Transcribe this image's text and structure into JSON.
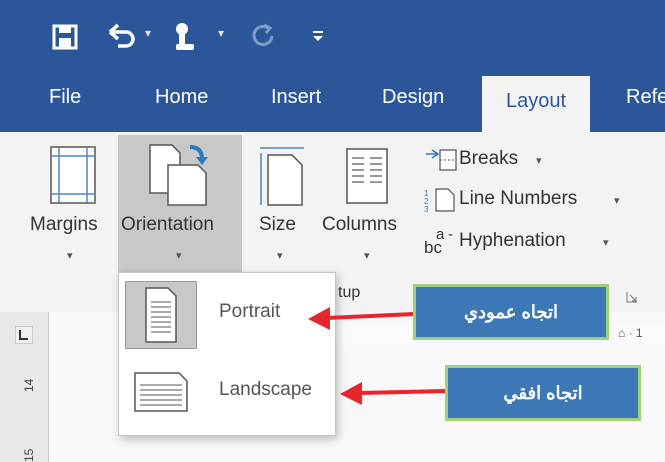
{
  "qat": {
    "icons": [
      "save-icon",
      "undo-icon",
      "touch-mode-icon",
      "redo-icon",
      "customize-icon"
    ]
  },
  "tabs": [
    {
      "label": "File"
    },
    {
      "label": "Home"
    },
    {
      "label": "Insert"
    },
    {
      "label": "Design"
    },
    {
      "label": "Layout",
      "active": true
    },
    {
      "label": "Refe"
    }
  ],
  "ribbon": {
    "margins_label": "Margins",
    "orientation_label": "Orientation",
    "size_label": "Size",
    "columns_label": "Columns",
    "breaks_label": "Breaks",
    "line_numbers_label": "Line Numbers",
    "hyphenation_label": "Hyphenation",
    "group_label_fragment": "tup"
  },
  "ruler": {
    "numbers": [
      "14",
      "15"
    ]
  },
  "orientation_menu": {
    "items": [
      {
        "label": "Portrait",
        "selected": true
      },
      {
        "label": "Landscape",
        "selected": false
      }
    ]
  },
  "callouts": {
    "portrait": "اتجاه عمودي",
    "landscape": "اتجاه افقي"
  },
  "colors": {
    "accent": "#2b579a",
    "callout_fill": "#3c78b5",
    "callout_border": "#9ed07a",
    "arrow": "#e8252a"
  }
}
